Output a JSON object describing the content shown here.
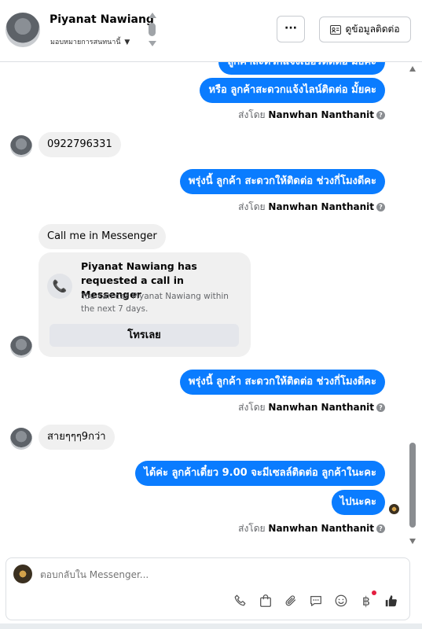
{
  "header": {
    "name": "Piyanat Nawiang",
    "assign_label": "มอบหมายการสนทนานี้",
    "contact_button": "ดูข้อมูลติดต่อ",
    "more_label": "···"
  },
  "messages": {
    "m1": "ลูกค้าสะดวกแจ้งเบอร์ติดต่อ มั้ยคะ",
    "m2": "หรือ ลูกค้าสะดวกแจ้งไลน์ติดต่อ มั้ยคะ",
    "m3": "0922796331",
    "m4": "พรุ่งนี้ ลูกค้า สะดวกให้ติดต่อ ช่วงกี่โมงดีคะ",
    "m5": "Call me in Messenger",
    "m6": "พรุ่งนี้ ลูกค้า สะดวกให้ติดต่อ ช่วงกี่โมงดีคะ",
    "m7": "สายๆๆๆ9กว่า",
    "m8": "ได้ค่ะ  ลูกค้าเดี๋ยว 9.00 จะมีเซลล์ติดต่อ ลูกค้าในะคะ",
    "m9": "ไปนะคะ"
  },
  "sent_by": {
    "prefix": "ส่งโดย",
    "agent": "Nanwhan Nanthanit"
  },
  "call_card": {
    "title": "Piyanat Nawiang has requested a call in Messenger",
    "desc": "You can call Piyanat Nawiang within the next 7 days.",
    "button": "โทรเลย"
  },
  "composer": {
    "placeholder": "ตอบกลับใน Messenger..."
  },
  "colors": {
    "outgoing": "#0a7cff",
    "incoming": "#f0f0f0"
  }
}
